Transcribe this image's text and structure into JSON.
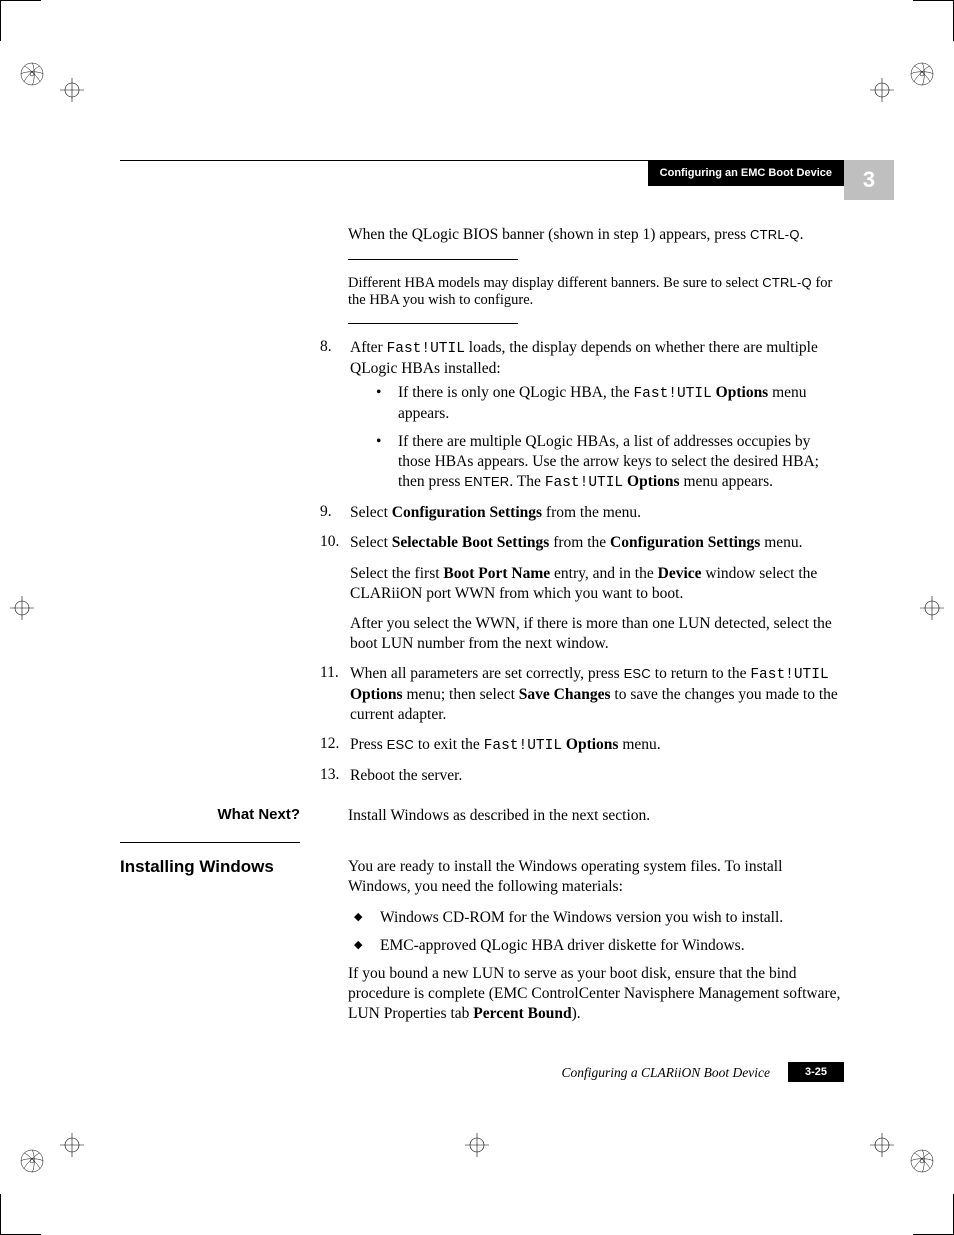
{
  "header": {
    "title": "Configuring an EMC Boot Device",
    "chapnum": "3"
  },
  "intro": {
    "p1a": "When the QLogic BIOS banner (shown in step 1) appears, press ",
    "p1b": "CTRL-Q",
    "p1c": "."
  },
  "note": {
    "a": "Different HBA models may display different banners. Be sure to select ",
    "b": "CTRL-Q",
    "c": " for the HBA you wish to configure."
  },
  "steps": {
    "s8": {
      "num": "8.",
      "a": "After ",
      "b": "Fast!UTIL",
      "c": " loads, the display depends on whether there are multiple QLogic HBAs installed:"
    },
    "s8b1": {
      "a": "If there is only one QLogic HBA, the ",
      "b": "Fast!UTIL",
      "c": " ",
      "d": "Options",
      "e": " menu appears."
    },
    "s8b2": {
      "a": "If there are multiple QLogic HBAs, a list of addresses occupies by those HBAs appears. Use the arrow keys to select the desired HBA; then press ",
      "b": "ENTER",
      "c": ". The ",
      "d": "Fast!UTIL",
      "e": " ",
      "f": "Options",
      "g": " menu appears."
    },
    "s9": {
      "num": "9.",
      "a": "Select ",
      "b": "Configuration Settings",
      "c": " from the menu."
    },
    "s10": {
      "num": "10.",
      "a": "Select ",
      "b": "Selectable Boot Settings",
      "c": " from the ",
      "d": "Configuration Settings",
      "e": " menu."
    },
    "s10p2": {
      "a": "Select the first ",
      "b": "Boot Port Name",
      "c": " entry, and in the ",
      "d": "Device",
      "e": " window select the CLARiiON port WWN from which you want to boot."
    },
    "s10p3": "After you select the WWN, if there is more than one LUN detected, select the boot LUN number from the next window.",
    "s11": {
      "num": "11.",
      "a": "When all parameters are set correctly, press ",
      "b": "ESC",
      "c": " to return to the ",
      "d": "Fast!UTIL",
      "e": " ",
      "f": "Options",
      "g": " menu; then select ",
      "h": "Save Changes",
      "i": " to save the changes you made to the current adapter."
    },
    "s12": {
      "num": "12.",
      "a": "Press ",
      "b": "ESC",
      "c": " to exit the ",
      "d": "Fast!UTIL",
      "e": " ",
      "f": "Options",
      "g": " menu."
    },
    "s13": {
      "num": "13.",
      "a": "Reboot the server."
    }
  },
  "whatnext": {
    "head": "What Next?",
    "body": "Install Windows as described in the next section."
  },
  "install": {
    "head": "Installing Windows",
    "p1": "You are ready to install the Windows operating system files. To install Windows, you need the following materials:",
    "b1": "Windows CD-ROM for the Windows version you wish to install.",
    "b2": "EMC-approved QLogic HBA driver diskette for Windows.",
    "p2a": "If you bound a new LUN to serve as your boot disk, ensure that the bind procedure is complete (EMC ControlCenter Navisphere Management software, LUN Properties tab ",
    "p2b": "Percent Bound",
    "p2c": ")."
  },
  "footer": {
    "text": "Configuring a CLARiiON Boot Device",
    "page": "3-25"
  }
}
